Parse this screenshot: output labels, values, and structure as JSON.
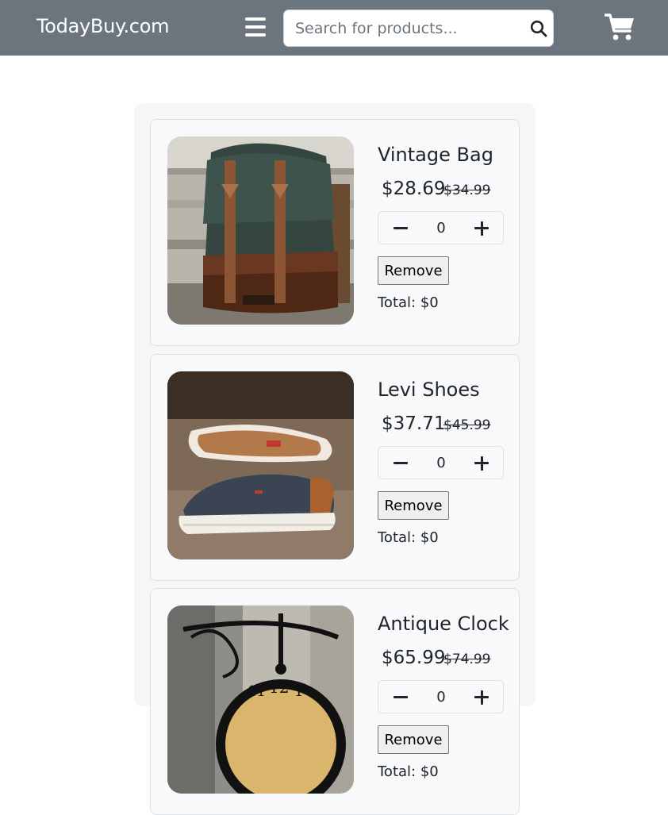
{
  "header": {
    "brand": "TodayBuy.com",
    "menu_icon": "hamburger-menu-icon",
    "search": {
      "placeholder": "Search for products...",
      "value": "",
      "icon": "search-icon"
    },
    "cart_icon": "shopping-cart-icon",
    "background_color": "#6c757d"
  },
  "cart": {
    "items": [
      {
        "name": "Vintage Bag",
        "price": "$28.69",
        "original_price": "$34.99",
        "quantity": "0",
        "remove_label": "Remove",
        "total": "Total: $0",
        "image": "vintage-bag-image"
      },
      {
        "name": "Levi Shoes",
        "price": "$37.71",
        "original_price": "$45.99",
        "quantity": "0",
        "remove_label": "Remove",
        "total": "Total: $0",
        "image": "levi-shoes-image"
      },
      {
        "name": "Antique Clock",
        "price": "$65.99",
        "original_price": "$74.99",
        "quantity": "0",
        "remove_label": "Remove",
        "total": "Total: $0",
        "image": "antique-clock-image"
      }
    ]
  }
}
